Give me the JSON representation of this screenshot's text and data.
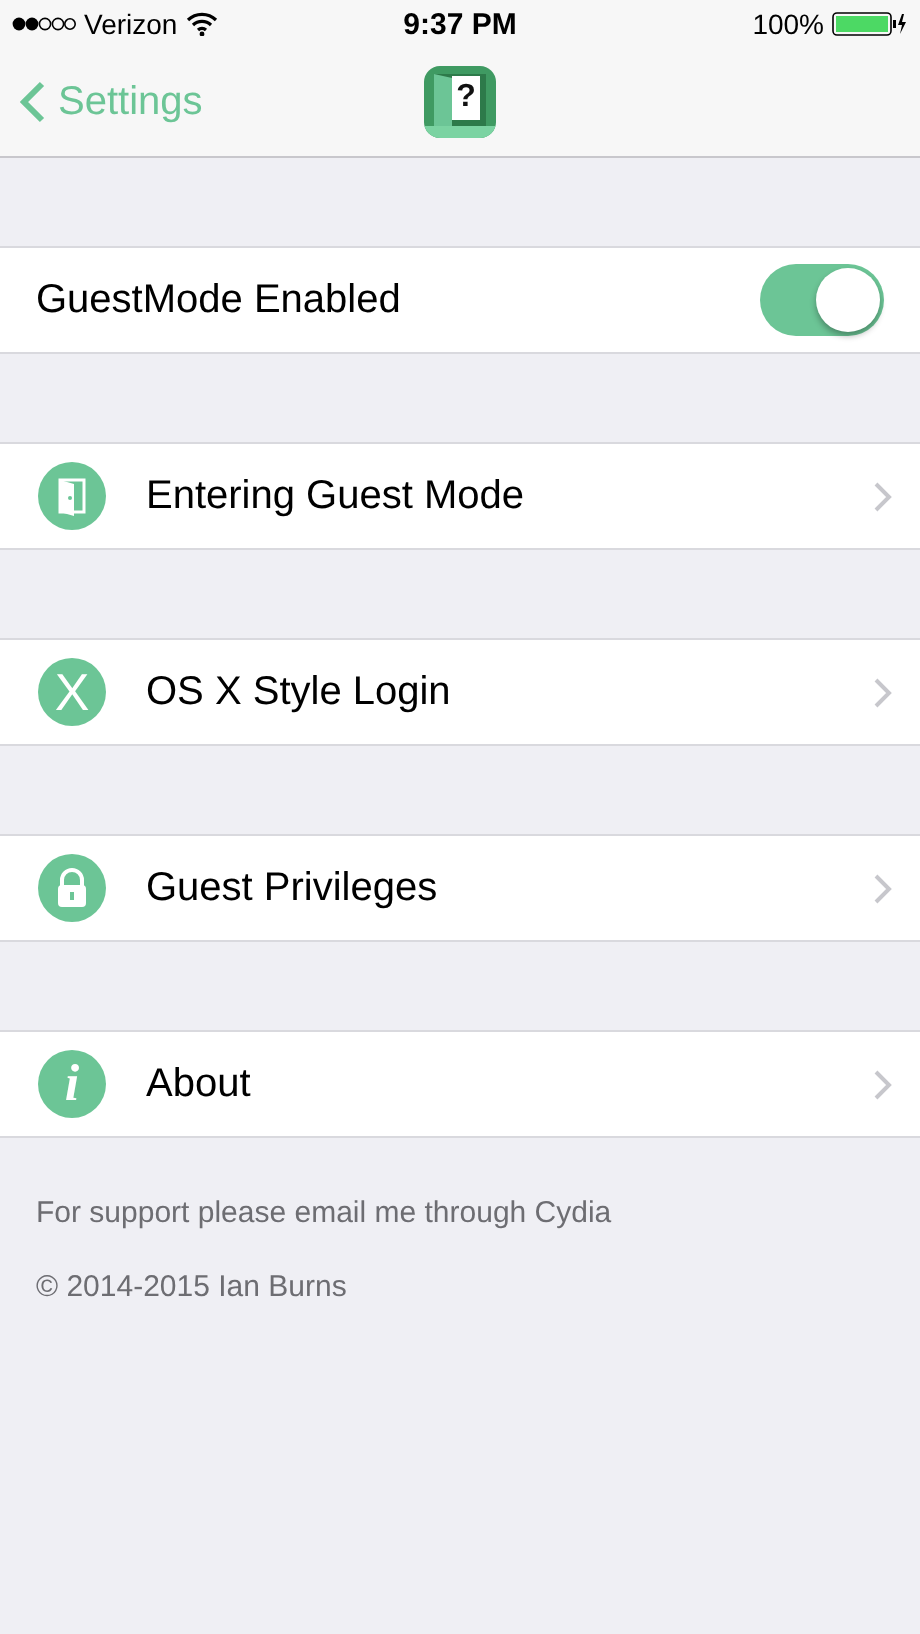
{
  "status_bar": {
    "carrier": "Verizon",
    "time": "9:37 PM",
    "battery": "100%"
  },
  "nav_bar": {
    "back": "Settings",
    "app_icon_glyph": "?"
  },
  "toggle": {
    "label": "GuestMode Enabled",
    "on": true
  },
  "items": [
    {
      "label": "Entering Guest Mode",
      "kind": "door"
    },
    {
      "label": "OS X Style Login",
      "kind": "letter",
      "glyph": "X"
    },
    {
      "label": "Guest Privileges",
      "kind": "lock"
    },
    {
      "label": "About",
      "kind": "info",
      "glyph": "i"
    }
  ],
  "footer": [
    "For support please email me through Cydia",
    "© 2014-2015 Ian Burns"
  ]
}
